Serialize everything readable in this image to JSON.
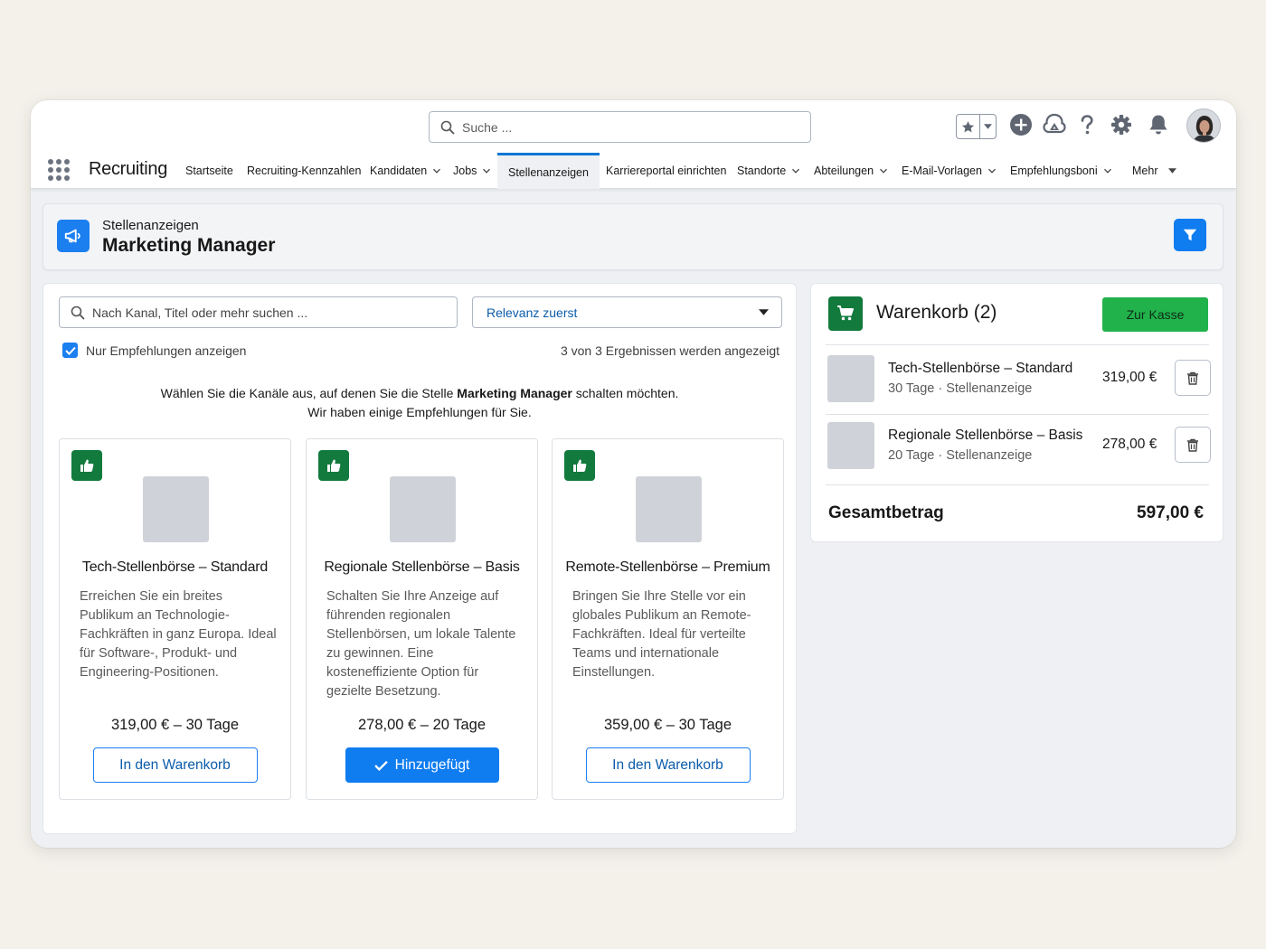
{
  "header": {
    "search_placeholder": "Suche ...",
    "app_name": "Recruiting",
    "nav": [
      {
        "label": "Startseite",
        "dropdown": false
      },
      {
        "label": "Recruiting-Kennzahlen",
        "dropdown": false
      },
      {
        "label": "Kandidaten",
        "dropdown": true
      },
      {
        "label": "Jobs",
        "dropdown": true
      },
      {
        "label": "Stellenanzeigen",
        "dropdown": false,
        "active": true
      },
      {
        "label": "Karriereportal einrichten",
        "dropdown": false
      },
      {
        "label": "Standorte",
        "dropdown": true
      },
      {
        "label": "Abteilungen",
        "dropdown": true
      },
      {
        "label": "E-Mail-Vorlagen",
        "dropdown": true
      },
      {
        "label": "Empfehlungsboni",
        "dropdown": true
      },
      {
        "label": "Mehr",
        "dropdown": true
      }
    ],
    "icons": [
      "star-icon",
      "plus-icon",
      "trailhead-icon",
      "help-icon",
      "gear-icon",
      "bell-icon"
    ]
  },
  "page_header": {
    "eyebrow": "Stellenanzeigen",
    "title": "Marketing Manager"
  },
  "main": {
    "search_placeholder": "Nach Kanal, Titel oder mehr suchen ...",
    "sort_value": "Relevanz zuerst",
    "checkbox_label": "Nur Empfehlungen anzeigen",
    "checkbox_checked": true,
    "results_text": "3 von 3 Ergebnissen werden angezeigt",
    "intro_before": "Wählen Sie die Kanäle aus, auf denen Sie die Stelle ",
    "intro_bold": "Marketing Manager",
    "intro_after": " schalten möchten.",
    "intro_line2": "Wir haben einige Empfehlungen für Sie.",
    "cards": [
      {
        "title": "Tech-Stellenbörse – Standard",
        "description": "Erreichen Sie ein breites Publikum an Technologie-Fachkräften in ganz Europa. Ideal für Software-, Produkt- und Engineering-Positionen.",
        "price": "319,00 € – 30 Tage",
        "button": "In den Warenkorb",
        "added": false
      },
      {
        "title": "Regionale Stellenbörse – Basis",
        "description": "Schalten Sie Ihre Anzeige auf führenden regionalen Stellenbörsen, um lokale Talente zu gewinnen. Eine kosteneffiziente Option für gezielte Besetzung.",
        "price": "278,00 € – 20 Tage",
        "button": "Hinzugefügt",
        "added": true
      },
      {
        "title": "Remote-Stellenbörse – Premium",
        "description": "Bringen Sie Ihre Stelle vor ein globales Publikum an Remote-Fachkräften. Ideal für verteilte Teams und internationale Einstellungen.",
        "price": "359,00 € – 30 Tage",
        "button": "In den Warenkorb",
        "added": false
      }
    ]
  },
  "cart": {
    "title": "Warenkorb (2)",
    "checkout_label": "Zur Kasse",
    "items": [
      {
        "name": "Tech-Stellenbörse – Standard",
        "meta": "30 Tage · Stellenanzeige",
        "price": "319,00 €"
      },
      {
        "name": "Regionale Stellenbörse – Basis",
        "meta": "20 Tage · Stellenanzeige",
        "price": "278,00 €"
      }
    ],
    "total_label": "Gesamtbetrag",
    "total_value": "597,00 €"
  },
  "colors": {
    "brand_blue": "#0f7cf0",
    "recommend_green": "#127a3d",
    "checkout_green": "#21b24b"
  }
}
